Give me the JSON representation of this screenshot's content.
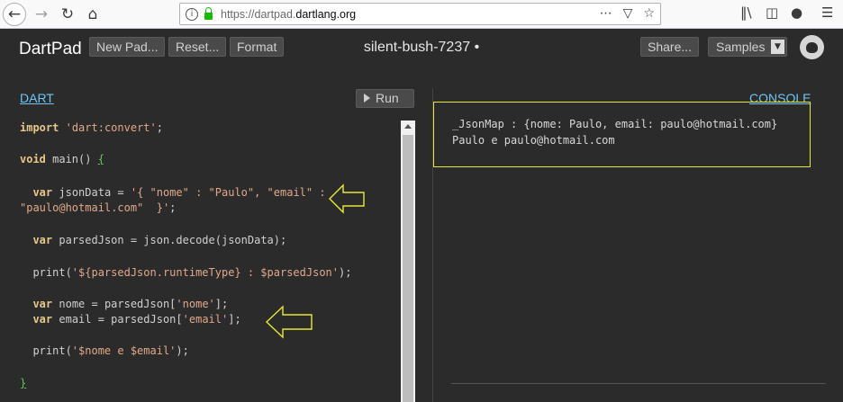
{
  "browser": {
    "url_prefix": "https://dartpad.",
    "url_domain": "dartlang.org",
    "icons": [
      "back-icon",
      "forward-icon",
      "reload-icon",
      "home-icon",
      "info-icon",
      "lock-icon",
      "page-actions-icon",
      "pocket-icon",
      "bookmark-star-icon",
      "library-icon",
      "sidebar-icon",
      "account-icon",
      "menu-icon"
    ]
  },
  "header": {
    "logo": "DartPad",
    "new_pad": "New Pad...",
    "reset": "Reset...",
    "format": "Format",
    "pad_name": "silent-bush-7237 •",
    "share": "Share...",
    "samples": "Samples"
  },
  "editor": {
    "tab": "DART",
    "run": "Run",
    "lines": [
      "import 'dart:convert';",
      "void main() {",
      "  var jsonData = '{ \"nome\" : \"Paulo\", \"email\" :",
      "\"paulo@hotmail.com\"  }';",
      "  var parsedJson = json.decode(jsonData);",
      "  print('${parsedJson.runtimeType} : $parsedJson');",
      "  var nome = parsedJson['nome'];",
      "  var email = parsedJson['email'];",
      "  print('$nome e $email');",
      "}"
    ]
  },
  "console": {
    "tab": "CONSOLE",
    "output": [
      "_JsonMap : {nome: Paulo, email: paulo@hotmail.com}",
      "Paulo e paulo@hotmail.com"
    ]
  },
  "colors": {
    "background": "#2b2b2b",
    "accent_tab": "#6fc6f2",
    "annotation": "#e8e832",
    "keyword": "#e7c78a",
    "string": "#e0a88a"
  }
}
